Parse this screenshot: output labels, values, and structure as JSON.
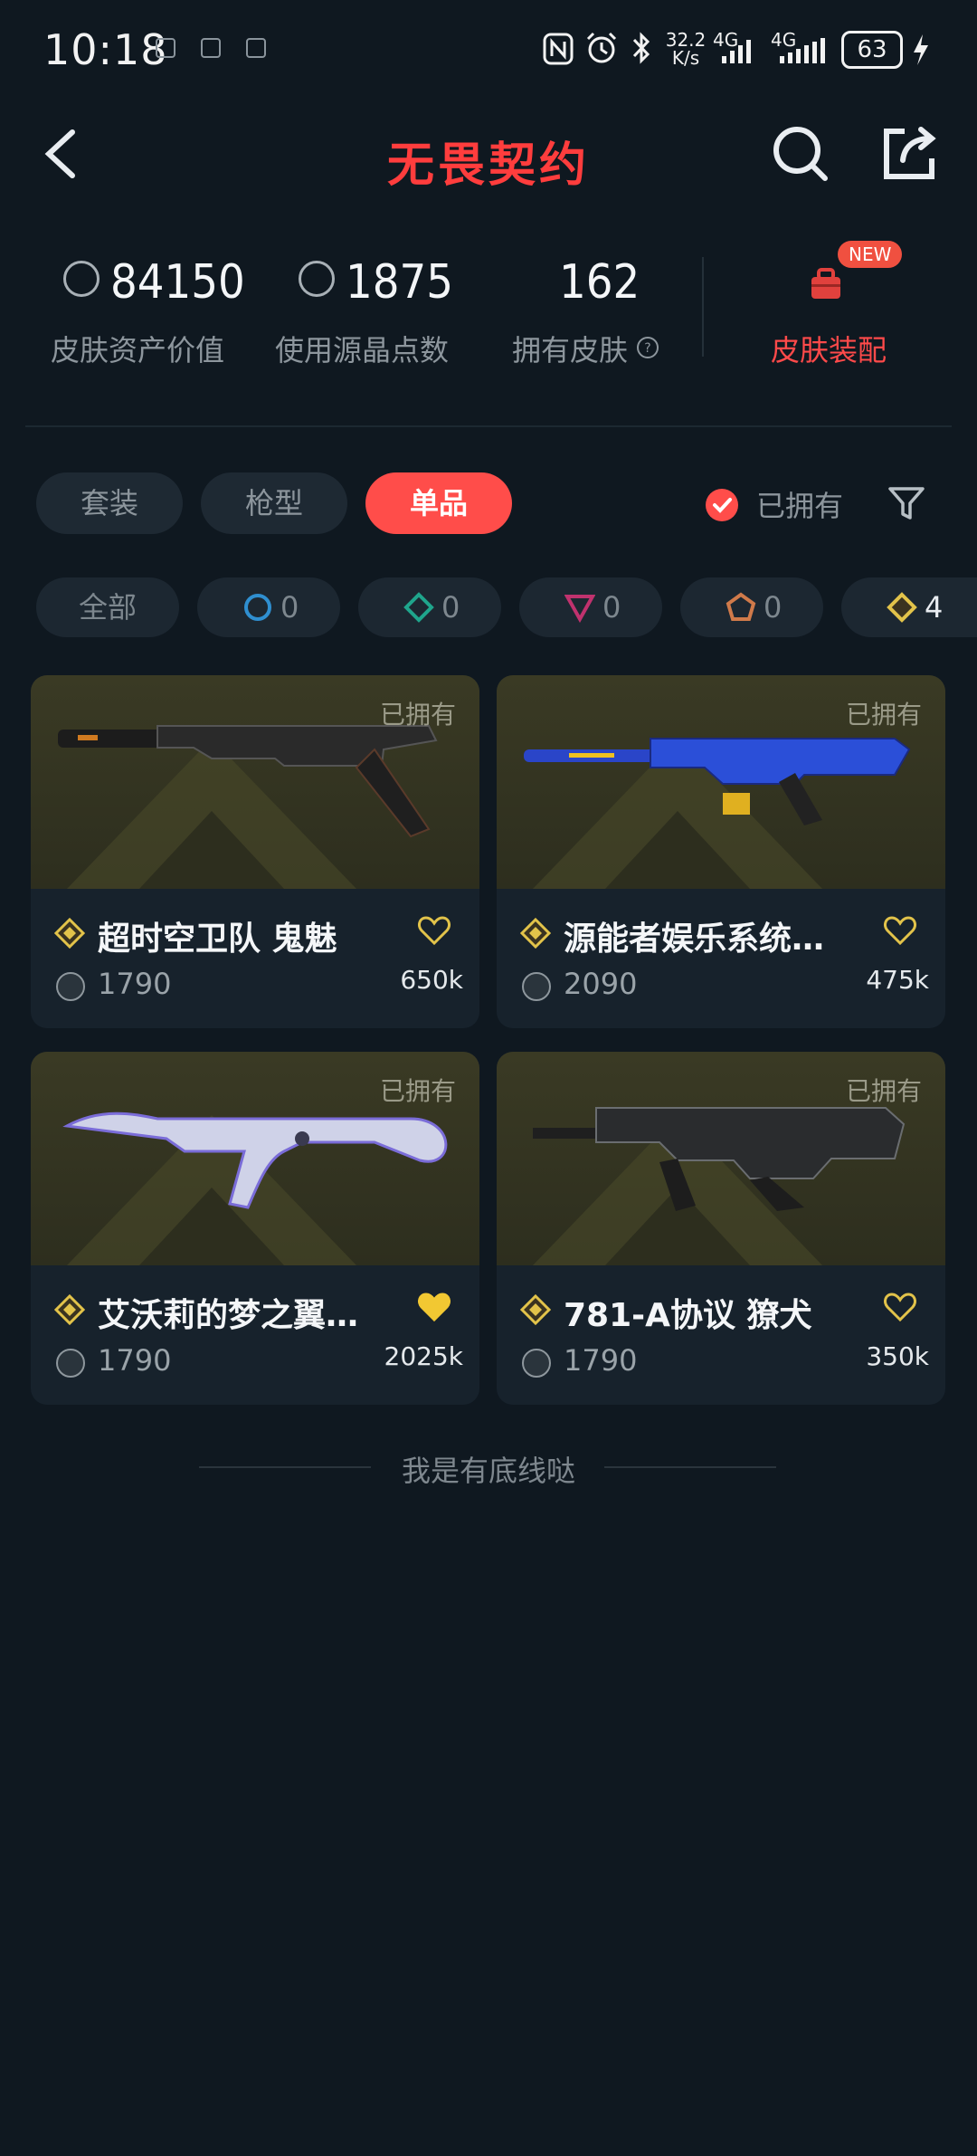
{
  "status_bar": {
    "time": "10:18",
    "speed_value": "32.2",
    "speed_unit": "K/s",
    "net1": "4G",
    "net2": "4G",
    "battery": "63",
    "icons": [
      "nfc-icon",
      "alarm-icon",
      "bluetooth-icon",
      "signal-icon",
      "signal-icon",
      "charging-icon"
    ]
  },
  "header": {
    "title": "无畏契约",
    "back_icon": "chevron-left-icon",
    "search_icon": "search-icon",
    "share_icon": "share-icon"
  },
  "stats": {
    "asset_value": "84150",
    "asset_label": "皮肤资产价值",
    "points_value": "1875",
    "points_label": "使用源晶点数",
    "owned_value": "162",
    "owned_label": "拥有皮肤",
    "equip_badge": "NEW",
    "equip_label": "皮肤装配"
  },
  "tabs": {
    "items": [
      "套装",
      "枪型",
      "单品"
    ],
    "active": "单品",
    "owned_filter_label": "已拥有",
    "filter_icon": "filter-icon"
  },
  "rarity_chips": [
    {
      "label": "全部"
    },
    {
      "count": "0",
      "color": "#2f8fd0"
    },
    {
      "count": "0",
      "color": "#1fa58c"
    },
    {
      "count": "0",
      "color": "#c0326e"
    },
    {
      "count": "0",
      "color": "#d07a4a"
    },
    {
      "count": "4",
      "color": "#e2c34a"
    }
  ],
  "cards": [
    {
      "owned": "已拥有",
      "name": "超时空卫队 鬼魅",
      "price": "1790",
      "likes": "650k",
      "liked": false
    },
    {
      "owned": "已拥有",
      "name": "源能者娱乐系统…",
      "price": "2090",
      "likes": "475k",
      "liked": false
    },
    {
      "owned": "已拥有",
      "name": "艾沃莉的梦之翼…",
      "price": "1790",
      "likes": "2025k",
      "liked": true
    },
    {
      "owned": "已拥有",
      "name": "781-A协议 獠犬",
      "price": "1790",
      "likes": "350k",
      "liked": false
    }
  ],
  "footer": {
    "text": "我是有底线哒"
  },
  "colors": {
    "accent": "#ff4d4a",
    "background": "#0f1820",
    "card": "#17222c",
    "gold": "#e2c34a"
  }
}
